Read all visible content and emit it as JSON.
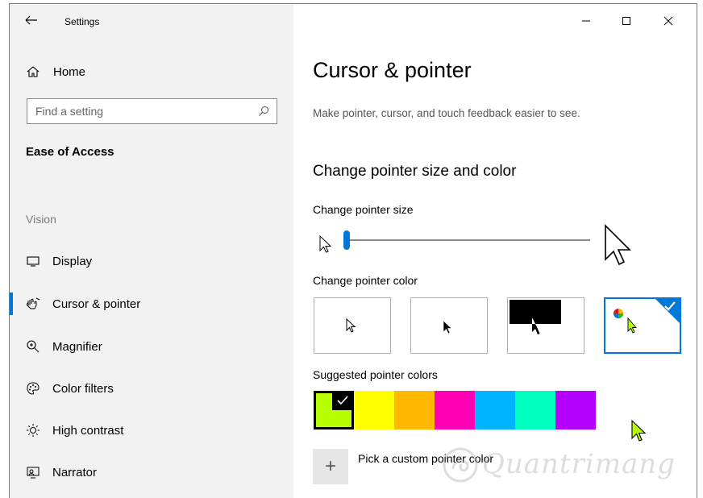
{
  "window": {
    "title": "Settings",
    "controls": {
      "minimize": "minimize",
      "maximize": "maximize",
      "close": "close"
    }
  },
  "sidebar": {
    "home_label": "Home",
    "search_placeholder": "Find a setting",
    "section_title": "Ease of Access",
    "group_label": "Vision",
    "items": [
      {
        "label": "Display",
        "icon": "display-icon",
        "active": false
      },
      {
        "label": "Cursor & pointer",
        "icon": "cursor-pointer-icon",
        "active": true
      },
      {
        "label": "Magnifier",
        "icon": "magnifier-icon",
        "active": false
      },
      {
        "label": "Color filters",
        "icon": "color-filters-icon",
        "active": false
      },
      {
        "label": "High contrast",
        "icon": "high-contrast-icon",
        "active": false
      },
      {
        "label": "Narrator",
        "icon": "narrator-icon",
        "active": false
      }
    ]
  },
  "main": {
    "title": "Cursor & pointer",
    "description": "Make pointer, cursor, and touch feedback easier to see.",
    "section_heading": "Change pointer size and color",
    "size_label": "Change pointer size",
    "pointer_size_level": 0.0,
    "color_label": "Change pointer color",
    "color_options": [
      {
        "name": "white",
        "selected": false
      },
      {
        "name": "black",
        "selected": false
      },
      {
        "name": "inverted",
        "selected": false
      },
      {
        "name": "custom",
        "selected": true
      }
    ],
    "suggested_label": "Suggested pointer colors",
    "suggested_colors": [
      "#b7ff00",
      "#ffff00",
      "#ffb900",
      "#ff00b4",
      "#00b4ff",
      "#00ffbf",
      "#b400ff"
    ],
    "selected_suggested_index": 0,
    "custom_color_label": "Pick a custom pointer color",
    "custom_plus": "+",
    "accent_color": "#0078d7",
    "pointer_color": "#b7ff00"
  },
  "watermark": {
    "text": "Quantrimang"
  }
}
